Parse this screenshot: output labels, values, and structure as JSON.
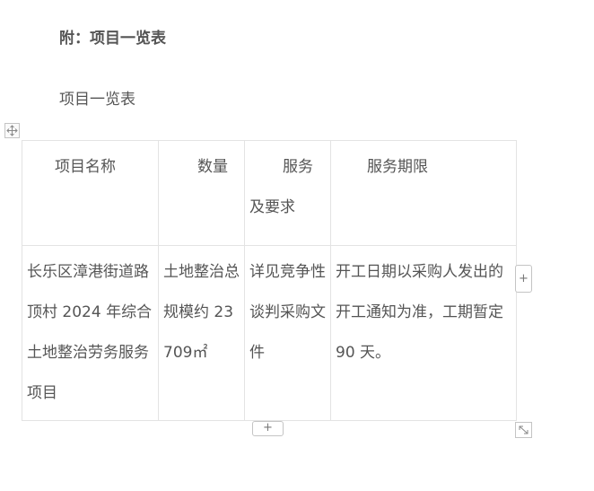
{
  "document": {
    "heading": "附：项目一览表",
    "subheading": "项目一览表"
  },
  "table": {
    "headers": {
      "name": "项目名称",
      "quantity": "数量",
      "service_line1": "服务",
      "service_line2": "及要求",
      "term": "服务期限"
    },
    "row": {
      "name": "长乐区漳港街道路顶村 2024 年综合土地整治劳务服务项目",
      "quantity": "土地整治总规模约 23709㎡",
      "service": "详见竞争性谈判采购文件",
      "term": "开工日期以采购人发出的开工通知为准，工期暂定 90 天。"
    }
  },
  "controls": {
    "add_column_label": "+",
    "add_row_label": "+",
    "move_icon": "move-icon",
    "resize_icon": "resize-icon"
  }
}
